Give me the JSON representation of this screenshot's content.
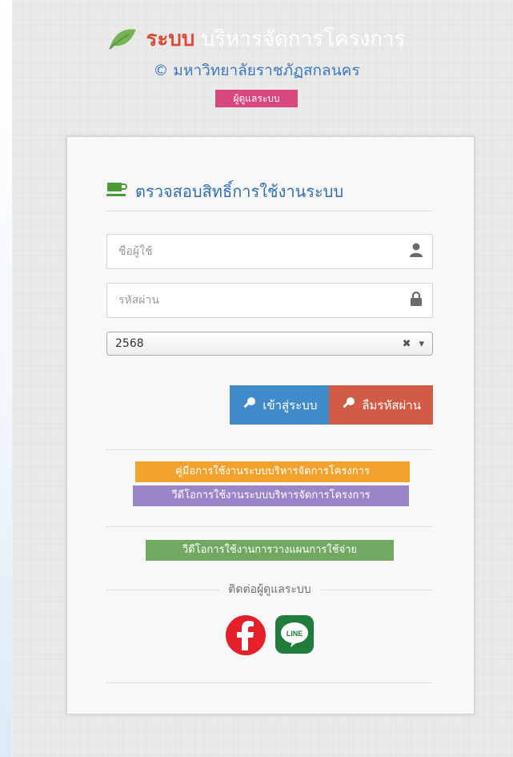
{
  "header": {
    "title_red": "ระบบ",
    "title_white": "บริหารจัดการโครงการ",
    "subtitle": "© มหาวิทยาลัยราชภัฏสกลนคร",
    "badge": "ผู้ดูแลระบบ"
  },
  "login": {
    "title": "ตรวจสอบสิทธิ์การใช้งานระบบ",
    "username_placeholder": "ชื่อผู้ใช้",
    "password_placeholder": "รหัสผ่าน",
    "year_value": "2568",
    "login_button": "เข้าสู่ระบบ",
    "forgot_button": "ลืมรหัสผ่าน"
  },
  "links": {
    "manual": "คู่มือการใช้งานระบบบริหารจัดการโครงการ",
    "video_project": "วีดีโอการใช้งานระบบบริหารจัดการโครงการ",
    "video_budget": "วีดีโอการใช้งานการวางแผนการใช้จ่าย"
  },
  "contact": {
    "label": "ติดต่อผู้ดูแลระบบ",
    "facebook_icon": "facebook-icon",
    "line_icon": "line-icon",
    "line_text": "LINE"
  },
  "colors": {
    "red": "#dd4b39",
    "blue": "#428bca",
    "green": "#72a962",
    "orange": "#f0a22c",
    "purple": "#9b85c9",
    "pink": "#d6487e"
  }
}
